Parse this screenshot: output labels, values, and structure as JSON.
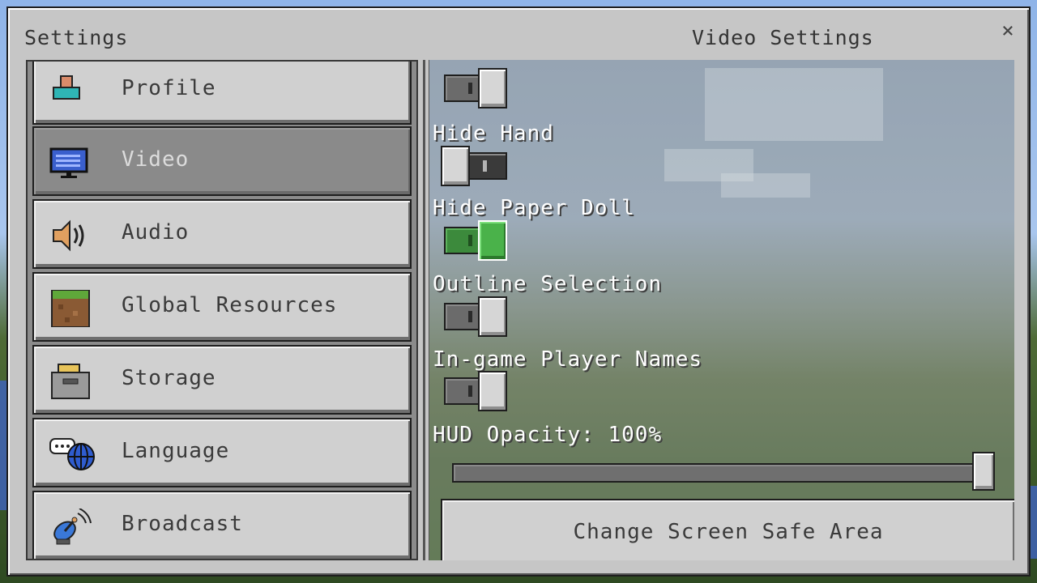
{
  "window": {
    "title_left": "Settings",
    "title_right": "Video Settings",
    "close_glyph": "×"
  },
  "sidebar": {
    "items": [
      {
        "label": "Profile",
        "icon": "profile-icon",
        "active": false
      },
      {
        "label": "Video",
        "icon": "monitor-icon",
        "active": true
      },
      {
        "label": "Audio",
        "icon": "speaker-icon",
        "active": false
      },
      {
        "label": "Global Resources",
        "icon": "grass-block-icon",
        "active": false
      },
      {
        "label": "Storage",
        "icon": "storage-box-icon",
        "active": false
      },
      {
        "label": "Language",
        "icon": "globe-chat-icon",
        "active": false
      },
      {
        "label": "Broadcast",
        "icon": "satellite-dish-icon",
        "active": false
      }
    ]
  },
  "video_settings": {
    "settings": [
      {
        "label": "Hide Hand",
        "state": "off"
      },
      {
        "label": "Hide Paper Doll",
        "state": "on"
      },
      {
        "label": "Outline Selection",
        "state": "off"
      },
      {
        "label": "In-game Player Names",
        "state": "off"
      }
    ],
    "hud_opacity": {
      "label": "HUD Opacity: 100%",
      "value_percent": 100
    },
    "change_safe_area_button": "Change Screen Safe Area"
  },
  "colors": {
    "panel_gray": "#c6c6c6",
    "toggle_on_green": "#4ab24a",
    "text_white": "#ffffff"
  }
}
